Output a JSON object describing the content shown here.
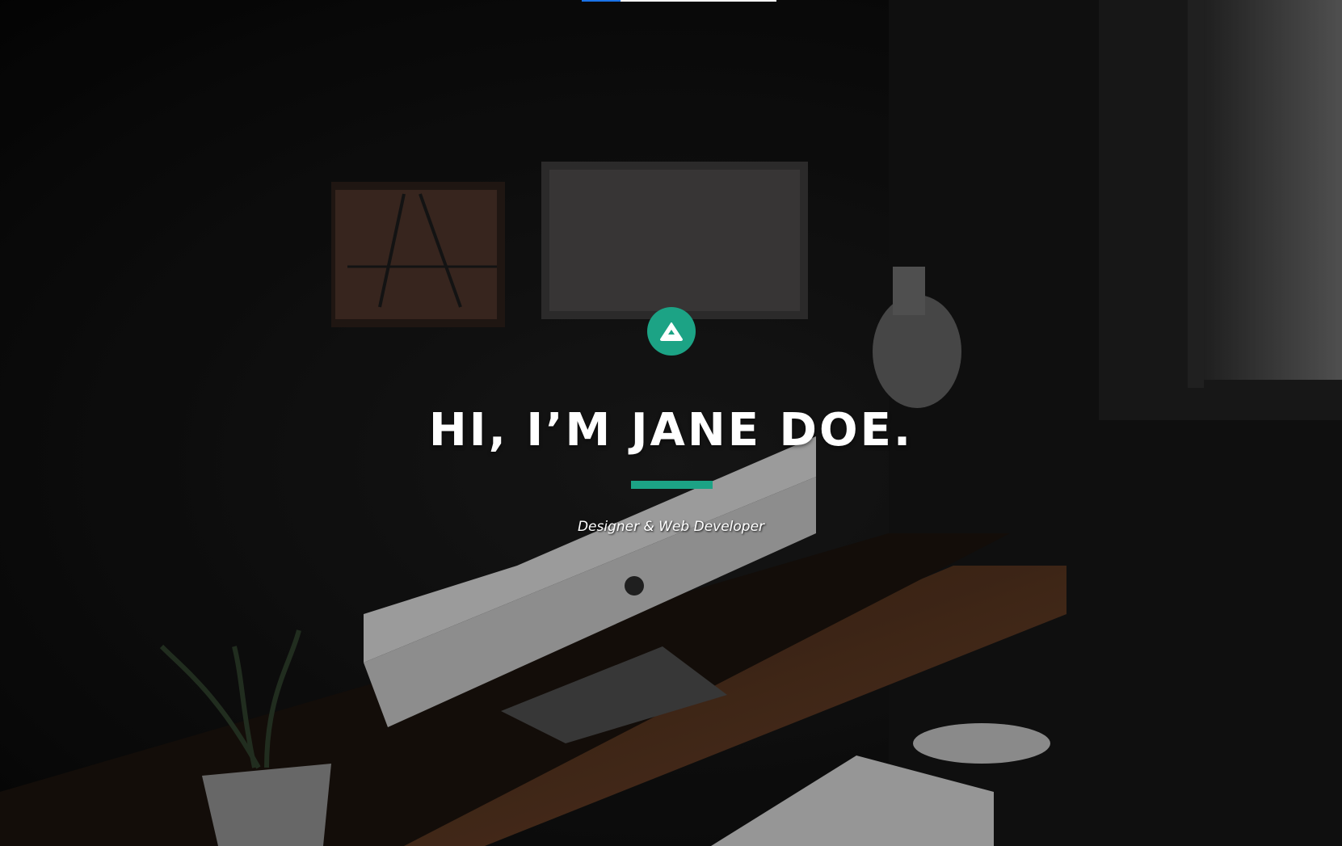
{
  "hero": {
    "headline": "HI, I’M JANE DOE.",
    "tagline": "Designer & Web Developer",
    "logo_icon": "mountain-icon"
  },
  "colors": {
    "accent": "#1ca385",
    "background": "#0a0a0a",
    "text": "#ffffff",
    "progress": "#1a73e8"
  },
  "page_progress": 0.2
}
